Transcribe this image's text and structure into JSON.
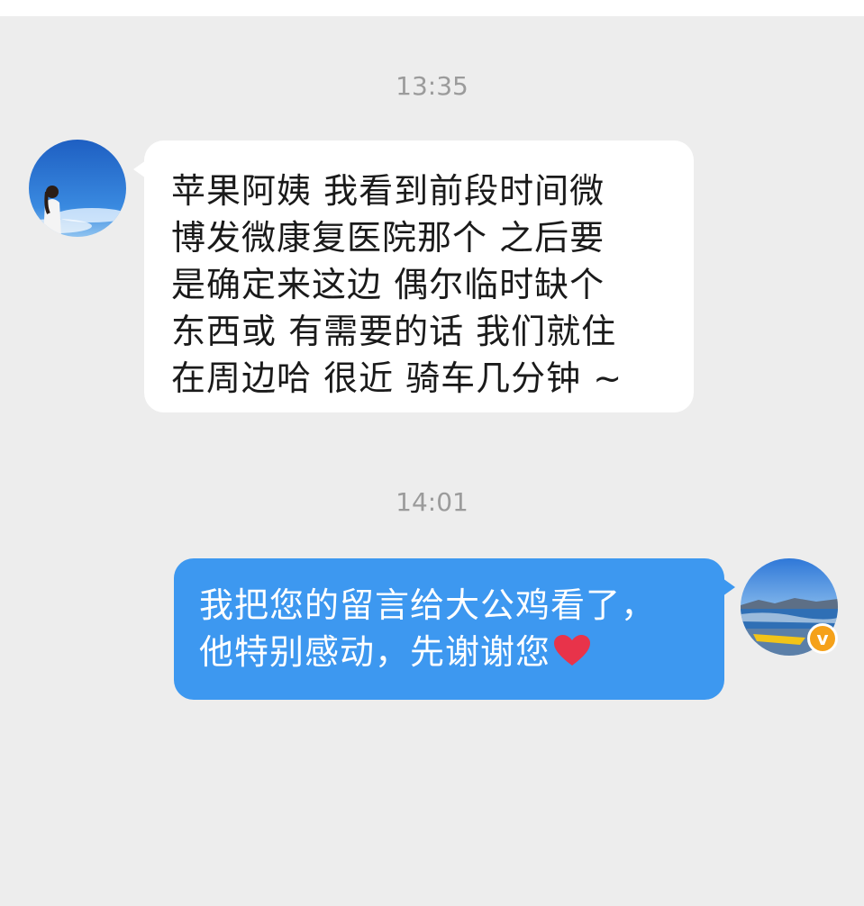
{
  "chat": {
    "messages": [
      {
        "time": "13:35",
        "direction": "incoming",
        "lines": [
          "苹果阿姨 我看到前段时间微",
          "博发微康复医院那个 之后要",
          "是确定来这边 偶尔临时缺个",
          "东西或 有需要的话  我们就住",
          "在周边哈 很近 骑车几分钟 ~"
        ]
      },
      {
        "time": "14:01",
        "direction": "outgoing",
        "lines": [
          "我把您的留言给大公鸡看了，",
          "他特别感动，先谢谢您"
        ],
        "emoji": "red-heart-icon"
      }
    ],
    "verified_badge": "v"
  },
  "colors": {
    "background": "#ededed",
    "incoming_bubble": "#ffffff",
    "outgoing_bubble": "#3d98f0",
    "timestamp": "#9b9b9b",
    "badge": "#f5a11a",
    "heart": "#e8334a"
  }
}
